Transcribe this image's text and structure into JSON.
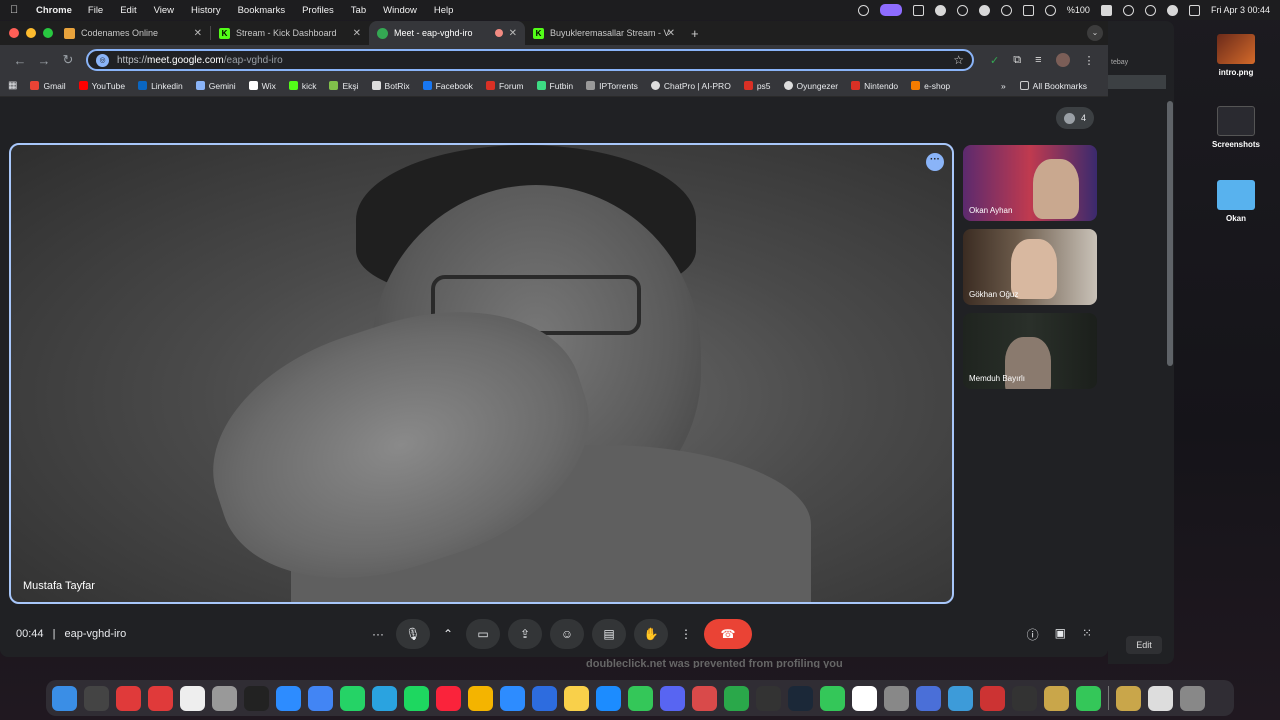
{
  "menubar": {
    "app_name": "Chrome",
    "menus": [
      "File",
      "Edit",
      "View",
      "History",
      "Bookmarks",
      "Profiles",
      "Tab",
      "Window",
      "Help"
    ],
    "battery": "%100",
    "datetime": "Fri Apr 3  00:44"
  },
  "tabs": [
    {
      "title": "Codenames Online",
      "color": "#e8a33c",
      "active": false
    },
    {
      "title": "Stream - Kick Dashboard",
      "color": "#53fc18",
      "active": false
    },
    {
      "title": "Meet - eap-vghd-iro",
      "color": "#34a853",
      "active": true
    },
    {
      "title": "Buyukleremasallar Stream - V",
      "color": "#53fc18",
      "active": false
    }
  ],
  "omnibox": {
    "scheme": "https://",
    "host": "meet.google.com",
    "path": "/eap-vghd-iro"
  },
  "bookmarks": [
    {
      "label": "Gmail",
      "color": "#ea4335"
    },
    {
      "label": "YouTube",
      "color": "#ff0000"
    },
    {
      "label": "Linkedin",
      "color": "#0a66c2"
    },
    {
      "label": "Gemini",
      "color": "#8ab4f8"
    },
    {
      "label": "Wix",
      "color": "#ffffff"
    },
    {
      "label": "kick",
      "color": "#53fc18"
    },
    {
      "label": "Ekşi",
      "color": "#81c14b"
    },
    {
      "label": "BotRix",
      "color": "#dddddd"
    },
    {
      "label": "Facebook",
      "color": "#1877f2"
    },
    {
      "label": "Forum",
      "color": "#d93025"
    },
    {
      "label": "Futbin",
      "color": "#3ddc84"
    },
    {
      "label": "IPTorrents",
      "color": "#999999"
    },
    {
      "label": "ChatPro | AI-PRO",
      "color": "#dddddd"
    },
    {
      "label": "ps5",
      "color": "#d93025"
    },
    {
      "label": "Oyungezer",
      "color": "#dddddd"
    },
    {
      "label": "Nintendo",
      "color": "#d93025"
    },
    {
      "label": "e-shop",
      "color": "#f57c00"
    }
  ],
  "all_bookmarks": "All Bookmarks",
  "meet": {
    "participant_count": "4",
    "main_speaker": "Mustafa Tayfar",
    "participants": [
      {
        "name": "Okan Ayhan"
      },
      {
        "name": "Gökhan Oğuz"
      },
      {
        "name": "Memduh Bayırlı"
      }
    ],
    "time": "00:44",
    "separator": "|",
    "meeting_code": "eap-vghd-iro"
  },
  "notice_text": "doubleclick.net was prevented from profiling you",
  "background_window": {
    "tab_fragment": "tebay",
    "edit_label": "Edit"
  },
  "desktop_icons": [
    {
      "label": "intro.png"
    },
    {
      "label": "Screenshots"
    },
    {
      "label": "Okan"
    }
  ],
  "dock_colors": [
    "#3a8ee6",
    "#444",
    "#e03a3a",
    "#e03a3a",
    "#eee",
    "#999",
    "#222",
    "#2d8cff",
    "#4285f4",
    "#25d366",
    "#2aa3e0",
    "#1ed760",
    "#fa233b",
    "#f4b400",
    "#2d8cff",
    "#2d6cdf",
    "#f9d04a",
    "#1c8cff",
    "#34c759",
    "#5865f2",
    "#d94a4a",
    "#2aa84a",
    "#333",
    "#1b2838",
    "#34c759",
    "#fff",
    "#888",
    "#4a6fd8",
    "#3d9bd9",
    "#c33",
    "#333",
    "#c9a64a",
    "#34c759",
    "#c9a64a",
    "#ddd",
    "#888"
  ]
}
